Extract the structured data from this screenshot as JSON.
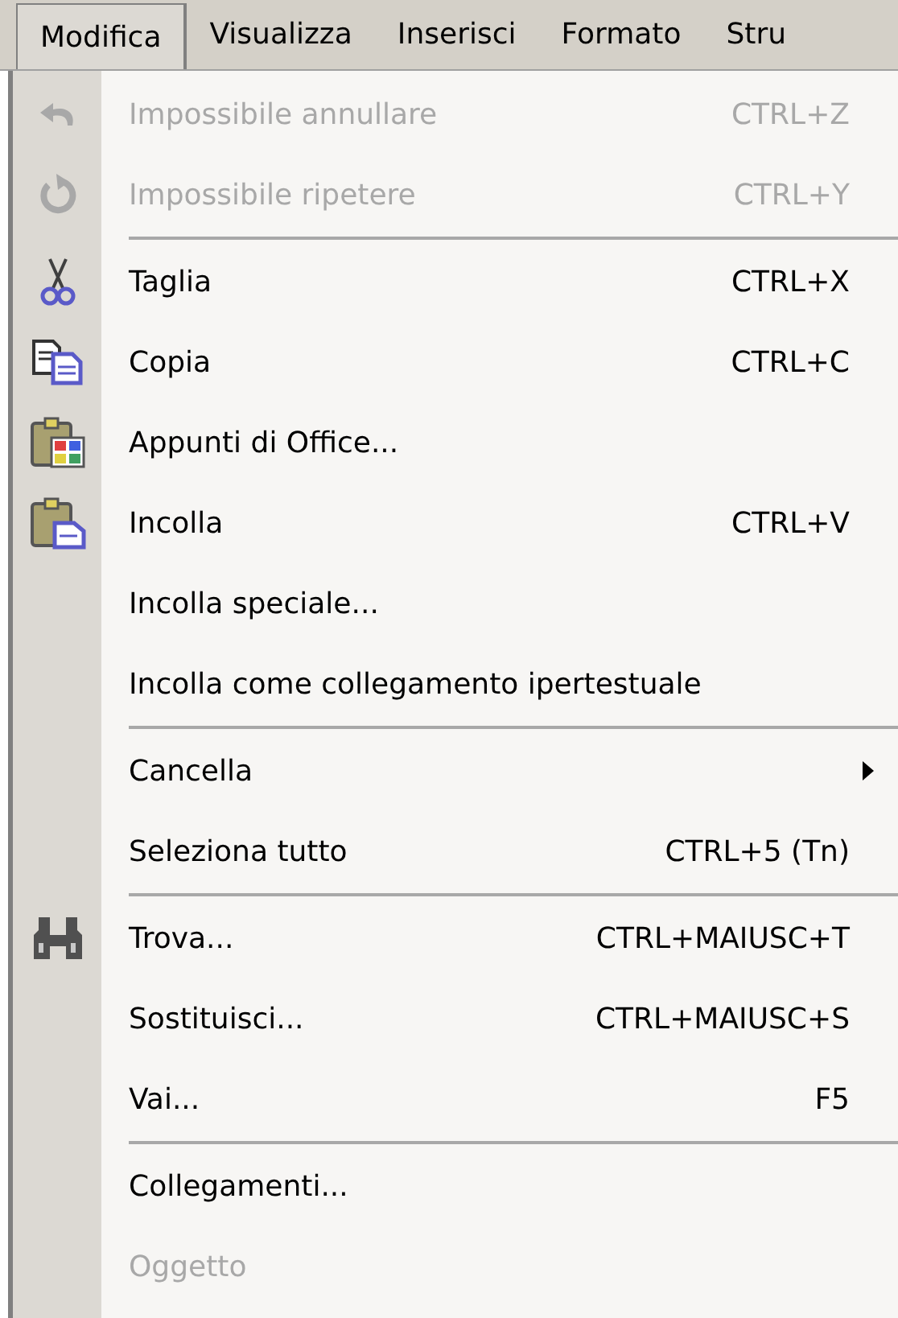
{
  "menu_bar": [
    {
      "label": "Modifica",
      "selected": true
    },
    {
      "label": "Visualizza",
      "selected": false
    },
    {
      "label": "Inserisci",
      "selected": false
    },
    {
      "label": "Formato",
      "selected": false
    },
    {
      "label": "Stru",
      "selected": false
    }
  ],
  "menu": {
    "items": [
      {
        "kind": "item",
        "label": "Impossibile annullare",
        "shortcut": "CTRL+Z",
        "disabled": true
      },
      {
        "kind": "item",
        "label": "Impossibile ripetere",
        "shortcut": "CTRL+Y",
        "disabled": true
      },
      {
        "kind": "separator"
      },
      {
        "kind": "item",
        "label": "Taglia",
        "shortcut": "CTRL+X",
        "disabled": false
      },
      {
        "kind": "item",
        "label": "Copia",
        "shortcut": "CTRL+C",
        "disabled": false
      },
      {
        "kind": "item",
        "label": "Appunti di Office...",
        "disabled": false
      },
      {
        "kind": "item",
        "label": "Incolla",
        "shortcut": "CTRL+V",
        "disabled": false
      },
      {
        "kind": "item",
        "label": "Incolla speciale...",
        "disabled": false
      },
      {
        "kind": "item",
        "label": "Incolla come collegamento ipertestuale",
        "disabled": false
      },
      {
        "kind": "separator"
      },
      {
        "kind": "item",
        "label": "Cancella",
        "disabled": false,
        "has_submenu": true
      },
      {
        "kind": "item",
        "label": "Seleziona tutto",
        "shortcut": "CTRL+5 (Tn)",
        "disabled": false
      },
      {
        "kind": "separator"
      },
      {
        "kind": "item",
        "label": "Trova...",
        "shortcut": "CTRL+MAIUSC+T",
        "disabled": false
      },
      {
        "kind": "item",
        "label": "Sostituisci...",
        "shortcut": "CTRL+MAIUSC+S",
        "disabled": false
      },
      {
        "kind": "item",
        "label": "Vai...",
        "shortcut": "F5",
        "disabled": false
      },
      {
        "kind": "separator"
      },
      {
        "kind": "item",
        "label": "Collegamenti...",
        "disabled": false
      },
      {
        "kind": "item",
        "label": "Oggetto",
        "disabled": true
      }
    ]
  }
}
